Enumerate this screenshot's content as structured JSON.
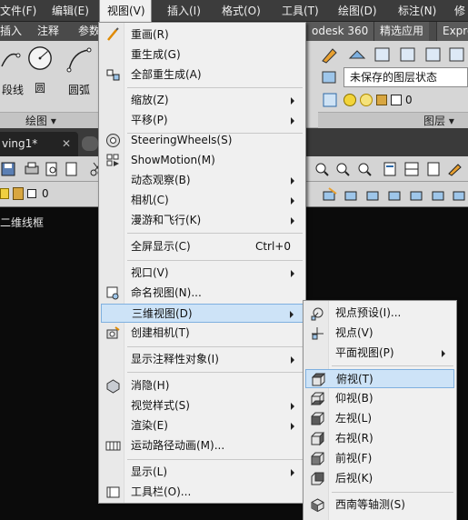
{
  "menubar": {
    "items": [
      "文件(F)",
      "编辑(E)",
      "视图(V)",
      "插入(I)",
      "格式(O)",
      "工具(T)",
      "绘图(D)",
      "标注(N)",
      "修"
    ]
  },
  "ribbon": {
    "tabs": [
      "插入",
      "注释",
      "参数",
      "odesk 360",
      "精选应用",
      "Expre"
    ],
    "draw_tools": [
      "段线",
      "圆",
      "圆弧"
    ],
    "draw_panel_title": "绘图 ▾",
    "layer_panel_title": "图层 ▾",
    "layer_state": "未保存的图层状态",
    "layer_current": "0"
  },
  "doc_tab": {
    "title": "ving1*",
    "close": "✕"
  },
  "toolbar2": {
    "layer_value": "0"
  },
  "viewport_label": "二维线框",
  "view_menu": {
    "items": [
      {
        "label": "重画(R)"
      },
      {
        "label": "重生成(G)"
      },
      {
        "label": "全部重生成(A)"
      },
      {
        "label": "缩放(Z)"
      },
      {
        "label": "平移(P)"
      },
      {
        "label": "SteeringWheels(S)"
      },
      {
        "label": "ShowMotion(M)"
      },
      {
        "label": "动态观察(B)"
      },
      {
        "label": "相机(C)"
      },
      {
        "label": "漫游和飞行(K)"
      },
      {
        "label": "全屏显示(C)",
        "shortcut": "Ctrl+0"
      },
      {
        "label": "视口(V)"
      },
      {
        "label": "命名视图(N)..."
      },
      {
        "label": "三维视图(D)"
      },
      {
        "label": "创建相机(T)"
      },
      {
        "label": "显示注释性对象(I)"
      },
      {
        "label": "消隐(H)"
      },
      {
        "label": "视觉样式(S)"
      },
      {
        "label": "渲染(E)"
      },
      {
        "label": "运动路径动画(M)..."
      },
      {
        "label": "显示(L)"
      },
      {
        "label": "工具栏(O)..."
      }
    ]
  },
  "view3d_submenu": {
    "items": [
      {
        "label": "视点预设(I)..."
      },
      {
        "label": "视点(V)"
      },
      {
        "label": "平面视图(P)"
      },
      {
        "label": "俯视(T)"
      },
      {
        "label": "仰视(B)"
      },
      {
        "label": "左视(L)"
      },
      {
        "label": "右视(R)"
      },
      {
        "label": "前视(F)"
      },
      {
        "label": "后视(K)"
      },
      {
        "label": "西南等轴测(S)"
      }
    ]
  },
  "colors": {
    "highlight": "#cde3f7",
    "highlight_border": "#7fb0df",
    "menu_bg": "#f0f0f0",
    "menubar_bg": "#3c3c3c"
  }
}
